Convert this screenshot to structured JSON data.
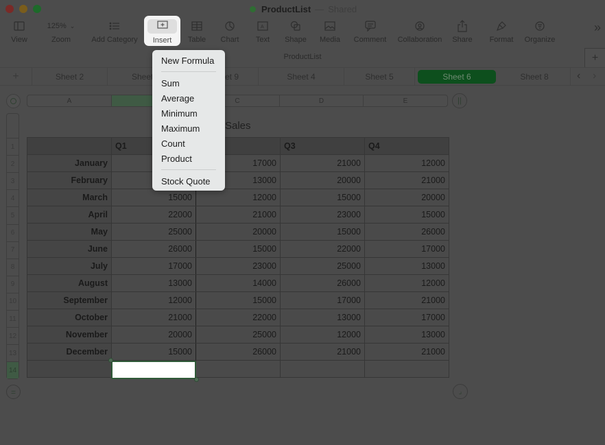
{
  "window": {
    "title": "ProductList",
    "separator": "—",
    "status": "Shared",
    "doc_name": "ProductList"
  },
  "toolbar": {
    "view": "View",
    "zoom_value": "125%",
    "zoom": "Zoom",
    "add_category": "Add Category",
    "insert": "Insert",
    "table": "Table",
    "chart": "Chart",
    "text": "Text",
    "shape": "Shape",
    "media": "Media",
    "comment": "Comment",
    "collaboration": "Collaboration",
    "share": "Share",
    "format": "Format",
    "organize": "Organize",
    "more": "»"
  },
  "tabs": {
    "add": "+",
    "items": [
      "Sheet 2",
      "Sheet 3",
      "Sheet 9",
      "Sheet 4",
      "Sheet 5",
      "Sheet 6",
      "Sheet 8"
    ],
    "active": "Sheet 6",
    "prev": "‹",
    "next": "›"
  },
  "insert_menu": {
    "items": [
      "New Formula",
      "Sum",
      "Average",
      "Minimum",
      "Maximum",
      "Count",
      "Product",
      "Stock Quote"
    ]
  },
  "grid": {
    "columns": [
      "A",
      "B",
      "C",
      "D",
      "E"
    ],
    "selected_column": "B",
    "rows": [
      "1",
      "2",
      "3",
      "4",
      "5",
      "6",
      "7",
      "8",
      "9",
      "10",
      "11",
      "12",
      "13",
      "14"
    ],
    "selected_row": "14"
  },
  "table": {
    "title": "Sales",
    "headers": [
      "",
      "Q1",
      "Q2",
      "Q3",
      "Q4"
    ],
    "rows": [
      {
        "month": "January",
        "values": [
          "",
          "17000",
          "21000",
          "12000"
        ]
      },
      {
        "month": "February",
        "values": [
          "",
          "13000",
          "20000",
          "21000"
        ]
      },
      {
        "month": "March",
        "values": [
          "15000",
          "12000",
          "15000",
          "20000"
        ]
      },
      {
        "month": "April",
        "values": [
          "22000",
          "21000",
          "23000",
          "15000"
        ]
      },
      {
        "month": "May",
        "values": [
          "25000",
          "20000",
          "15000",
          "26000"
        ]
      },
      {
        "month": "June",
        "values": [
          "26000",
          "15000",
          "22000",
          "17000"
        ]
      },
      {
        "month": "July",
        "values": [
          "17000",
          "23000",
          "25000",
          "13000"
        ]
      },
      {
        "month": "August",
        "values": [
          "13000",
          "14000",
          "26000",
          "12000"
        ]
      },
      {
        "month": "September",
        "values": [
          "12000",
          "15000",
          "17000",
          "21000"
        ]
      },
      {
        "month": "October",
        "values": [
          "21000",
          "22000",
          "13000",
          "17000"
        ]
      },
      {
        "month": "November",
        "values": [
          "20000",
          "25000",
          "12000",
          "13000"
        ]
      },
      {
        "month": "December",
        "values": [
          "15000",
          "26000",
          "21000",
          "21000"
        ]
      },
      {
        "month": "",
        "values": [
          "",
          "",
          "",
          ""
        ]
      }
    ]
  },
  "colors": {
    "accent_green": "#0d4f1d",
    "menu_bg": "#e6e8e8",
    "selection_border": "#2f5a38"
  }
}
